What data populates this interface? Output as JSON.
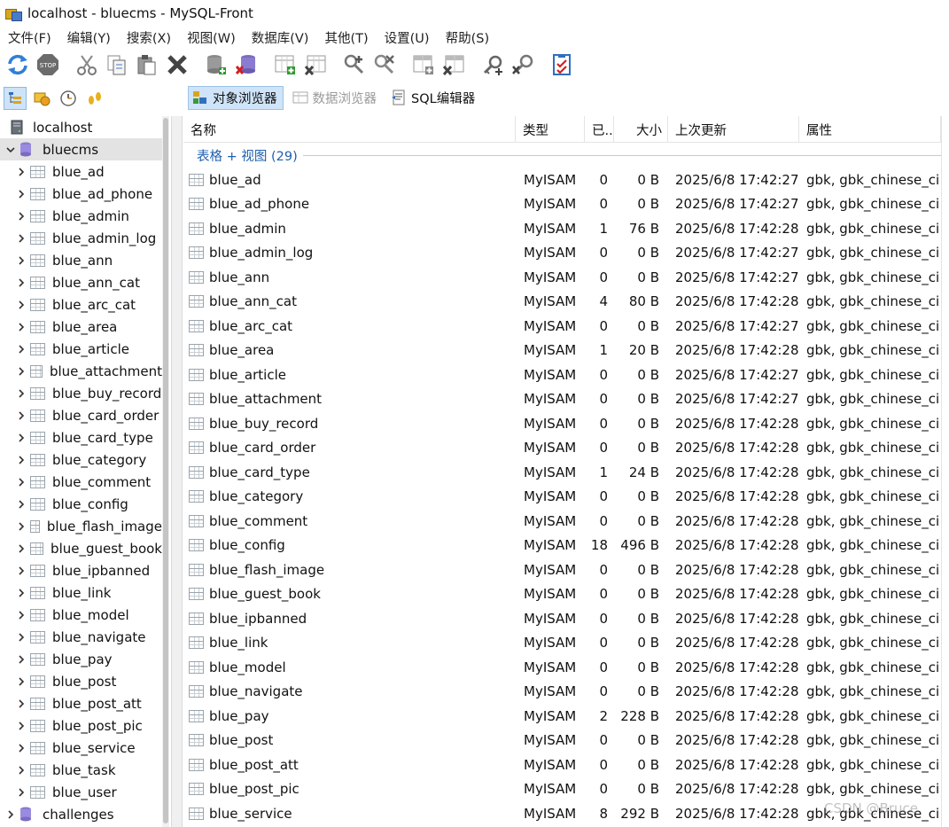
{
  "window": {
    "title": "localhost - bluecms - MySQL-Front"
  },
  "menu": [
    "文件(F)",
    "编辑(Y)",
    "搜索(X)",
    "视图(W)",
    "数据库(V)",
    "其他(T)",
    "设置(U)",
    "帮助(S)"
  ],
  "toolbar": {
    "buttons": [
      "refresh-icon",
      "stop-icon",
      "cut-icon",
      "copy-icon",
      "paste-icon",
      "delete-icon",
      "add-database-icon",
      "drop-database-icon",
      "add-table-icon",
      "drop-table-icon",
      "add-user-icon",
      "drop-user-icon",
      "add-field-icon",
      "drop-field-icon",
      "add-key-icon",
      "drop-key-icon",
      "properties-icon"
    ]
  },
  "toolbar2": {
    "tabs": [
      {
        "label": "对象浏览器",
        "icon": "object-browser-icon",
        "active": true
      },
      {
        "label": "数据浏览器",
        "icon": "data-browser-icon",
        "active": false
      },
      {
        "label": "SQL编辑器",
        "icon": "sql-editor-icon",
        "active": false
      }
    ]
  },
  "tree": {
    "root": "localhost",
    "database": "bluecms",
    "tables": [
      "blue_ad",
      "blue_ad_phone",
      "blue_admin",
      "blue_admin_log",
      "blue_ann",
      "blue_ann_cat",
      "blue_arc_cat",
      "blue_area",
      "blue_article",
      "blue_attachment",
      "blue_buy_record",
      "blue_card_order",
      "blue_card_type",
      "blue_category",
      "blue_comment",
      "blue_config",
      "blue_flash_image",
      "blue_guest_book",
      "blue_ipbanned",
      "blue_link",
      "blue_model",
      "blue_navigate",
      "blue_pay",
      "blue_post",
      "blue_post_att",
      "blue_post_pic",
      "blue_service",
      "blue_task",
      "blue_user"
    ],
    "next_database": "challenges"
  },
  "grid": {
    "columns": [
      "名称",
      "类型",
      "已...",
      "大小",
      "上次更新",
      "属性"
    ],
    "group_label": "表格 + 视图 (29)",
    "rows": [
      [
        "blue_ad",
        "MyISAM",
        "0",
        "0 B",
        "2025/6/8 17:42:27",
        "gbk, gbk_chinese_ci"
      ],
      [
        "blue_ad_phone",
        "MyISAM",
        "0",
        "0 B",
        "2025/6/8 17:42:27",
        "gbk, gbk_chinese_ci"
      ],
      [
        "blue_admin",
        "MyISAM",
        "1",
        "76 B",
        "2025/6/8 17:42:28",
        "gbk, gbk_chinese_ci"
      ],
      [
        "blue_admin_log",
        "MyISAM",
        "0",
        "0 B",
        "2025/6/8 17:42:27",
        "gbk, gbk_chinese_ci"
      ],
      [
        "blue_ann",
        "MyISAM",
        "0",
        "0 B",
        "2025/6/8 17:42:27",
        "gbk, gbk_chinese_ci"
      ],
      [
        "blue_ann_cat",
        "MyISAM",
        "4",
        "80 B",
        "2025/6/8 17:42:28",
        "gbk, gbk_chinese_ci"
      ],
      [
        "blue_arc_cat",
        "MyISAM",
        "0",
        "0 B",
        "2025/6/8 17:42:27",
        "gbk, gbk_chinese_ci"
      ],
      [
        "blue_area",
        "MyISAM",
        "1",
        "20 B",
        "2025/6/8 17:42:28",
        "gbk, gbk_chinese_ci"
      ],
      [
        "blue_article",
        "MyISAM",
        "0",
        "0 B",
        "2025/6/8 17:42:27",
        "gbk, gbk_chinese_ci"
      ],
      [
        "blue_attachment",
        "MyISAM",
        "0",
        "0 B",
        "2025/6/8 17:42:27",
        "gbk, gbk_chinese_ci"
      ],
      [
        "blue_buy_record",
        "MyISAM",
        "0",
        "0 B",
        "2025/6/8 17:42:28",
        "gbk, gbk_chinese_ci"
      ],
      [
        "blue_card_order",
        "MyISAM",
        "0",
        "0 B",
        "2025/6/8 17:42:28",
        "gbk, gbk_chinese_ci"
      ],
      [
        "blue_card_type",
        "MyISAM",
        "1",
        "24 B",
        "2025/6/8 17:42:28",
        "gbk, gbk_chinese_ci"
      ],
      [
        "blue_category",
        "MyISAM",
        "0",
        "0 B",
        "2025/6/8 17:42:28",
        "gbk, gbk_chinese_ci"
      ],
      [
        "blue_comment",
        "MyISAM",
        "0",
        "0 B",
        "2025/6/8 17:42:28",
        "gbk, gbk_chinese_ci"
      ],
      [
        "blue_config",
        "MyISAM",
        "18",
        "496 B",
        "2025/6/8 17:42:28",
        "gbk, gbk_chinese_ci"
      ],
      [
        "blue_flash_image",
        "MyISAM",
        "0",
        "0 B",
        "2025/6/8 17:42:28",
        "gbk, gbk_chinese_ci"
      ],
      [
        "blue_guest_book",
        "MyISAM",
        "0",
        "0 B",
        "2025/6/8 17:42:28",
        "gbk, gbk_chinese_ci"
      ],
      [
        "blue_ipbanned",
        "MyISAM",
        "0",
        "0 B",
        "2025/6/8 17:42:28",
        "gbk, gbk_chinese_ci"
      ],
      [
        "blue_link",
        "MyISAM",
        "0",
        "0 B",
        "2025/6/8 17:42:28",
        "gbk, gbk_chinese_ci"
      ],
      [
        "blue_model",
        "MyISAM",
        "0",
        "0 B",
        "2025/6/8 17:42:28",
        "gbk, gbk_chinese_ci"
      ],
      [
        "blue_navigate",
        "MyISAM",
        "0",
        "0 B",
        "2025/6/8 17:42:28",
        "gbk, gbk_chinese_ci"
      ],
      [
        "blue_pay",
        "MyISAM",
        "2",
        "228 B",
        "2025/6/8 17:42:28",
        "gbk, gbk_chinese_ci"
      ],
      [
        "blue_post",
        "MyISAM",
        "0",
        "0 B",
        "2025/6/8 17:42:28",
        "gbk, gbk_chinese_ci"
      ],
      [
        "blue_post_att",
        "MyISAM",
        "0",
        "0 B",
        "2025/6/8 17:42:28",
        "gbk, gbk_chinese_ci"
      ],
      [
        "blue_post_pic",
        "MyISAM",
        "0",
        "0 B",
        "2025/6/8 17:42:28",
        "gbk, gbk_chinese_ci"
      ],
      [
        "blue_service",
        "MyISAM",
        "8",
        "292 B",
        "2025/6/8 17:42:28",
        "gbk, gbk_chinese_ci"
      ]
    ]
  },
  "watermark": "CSDN @Bruce"
}
